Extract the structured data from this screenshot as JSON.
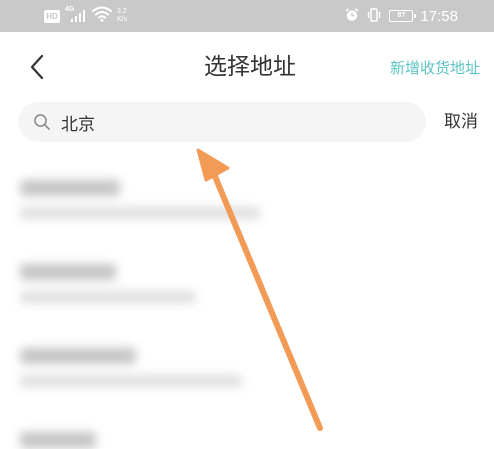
{
  "status_bar": {
    "hd_label": "HD",
    "network_label": "4G",
    "speed_value": "3.2",
    "speed_unit": "K/s",
    "battery_level": "87",
    "time": "17:58"
  },
  "header": {
    "title": "选择地址",
    "add_address_label": "新增收货地址"
  },
  "search": {
    "value": "北京",
    "cancel_label": "取消"
  },
  "results": {
    "blurred_count": 4
  },
  "colors": {
    "accent": "#5cc3c4",
    "annotation_arrow": "#f29b57",
    "status_bar_bg": "#c9c9c9"
  }
}
